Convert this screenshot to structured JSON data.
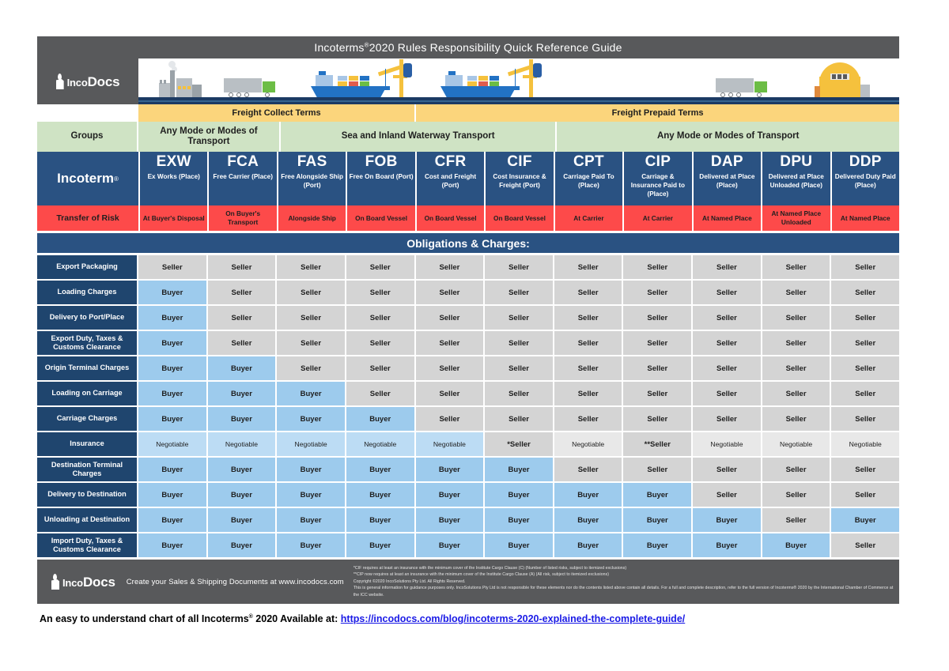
{
  "title": "Incoterms®2020 Rules Responsibility Quick Reference Guide",
  "title_main": "Incoterms",
  "title_reg": "®",
  "title_rest": "2020 Rules Responsibility Quick Reference Guide",
  "brand": {
    "name_inco": "Inco",
    "name_docs": "Docs",
    "full": "IncoDocs"
  },
  "freight_bands": [
    {
      "label": "Freight Collect Terms",
      "span": 4
    },
    {
      "label": "Freight Prepaid Terms",
      "span": 7
    }
  ],
  "groups": {
    "label": "Groups",
    "bands": [
      {
        "label": "Any Mode or Modes of Transport",
        "span": 2
      },
      {
        "label": "Sea and Inland Waterway Transport",
        "span": 4
      },
      {
        "label": "Any Mode or Modes of Transport",
        "span": 5
      }
    ]
  },
  "incoterm": {
    "label": "Incoterm",
    "reg": "®",
    "terms": [
      {
        "code": "EXW",
        "name": "Ex Works (Place)"
      },
      {
        "code": "FCA",
        "name": "Free Carrier (Place)"
      },
      {
        "code": "FAS",
        "name": "Free Alongside Ship (Port)"
      },
      {
        "code": "FOB",
        "name": "Free On Board (Port)"
      },
      {
        "code": "CFR",
        "name": "Cost and Freight (Port)"
      },
      {
        "code": "CIF",
        "name": "Cost Insurance & Freight (Port)"
      },
      {
        "code": "CPT",
        "name": "Carriage Paid To (Place)"
      },
      {
        "code": "CIP",
        "name": "Carriage & Insurance Paid to (Place)"
      },
      {
        "code": "DAP",
        "name": "Delivered at Place (Place)"
      },
      {
        "code": "DPU",
        "name": "Delivered at Place Unloaded (Place)"
      },
      {
        "code": "DDP",
        "name": "Delivered Duty Paid (Place)"
      }
    ]
  },
  "transfer_of_risk": {
    "label": "Transfer of Risk",
    "values": [
      "At Buyer's Disposal",
      "On Buyer's Transport",
      "Alongside Ship",
      "On Board Vessel",
      "On Board Vessel",
      "On Board Vessel",
      "At Carrier",
      "At Carrier",
      "At Named Place",
      "At Named Place Unloaded",
      "At Named Place"
    ]
  },
  "obligations_banner": "Obligations & Charges:",
  "chart_data": {
    "type": "table",
    "title": "Incoterms®2020 Rules Responsibility Quick Reference Guide",
    "columns": [
      "EXW",
      "FCA",
      "FAS",
      "FOB",
      "CFR",
      "CIF",
      "CPT",
      "CIP",
      "DAP",
      "DPU",
      "DDP"
    ],
    "rows": [
      {
        "label": "Export Packaging",
        "values": [
          "Seller",
          "Seller",
          "Seller",
          "Seller",
          "Seller",
          "Seller",
          "Seller",
          "Seller",
          "Seller",
          "Seller",
          "Seller"
        ]
      },
      {
        "label": "Loading Charges",
        "values": [
          "Buyer",
          "Seller",
          "Seller",
          "Seller",
          "Seller",
          "Seller",
          "Seller",
          "Seller",
          "Seller",
          "Seller",
          "Seller"
        ]
      },
      {
        "label": "Delivery to Port/Place",
        "values": [
          "Buyer",
          "Seller",
          "Seller",
          "Seller",
          "Seller",
          "Seller",
          "Seller",
          "Seller",
          "Seller",
          "Seller",
          "Seller"
        ]
      },
      {
        "label": "Export Duty, Taxes & Customs Clearance",
        "values": [
          "Buyer",
          "Seller",
          "Seller",
          "Seller",
          "Seller",
          "Seller",
          "Seller",
          "Seller",
          "Seller",
          "Seller",
          "Seller"
        ]
      },
      {
        "label": "Origin Terminal Charges",
        "values": [
          "Buyer",
          "Buyer",
          "Seller",
          "Seller",
          "Seller",
          "Seller",
          "Seller",
          "Seller",
          "Seller",
          "Seller",
          "Seller"
        ]
      },
      {
        "label": "Loading on Carriage",
        "values": [
          "Buyer",
          "Buyer",
          "Buyer",
          "Seller",
          "Seller",
          "Seller",
          "Seller",
          "Seller",
          "Seller",
          "Seller",
          "Seller"
        ]
      },
      {
        "label": "Carriage Charges",
        "values": [
          "Buyer",
          "Buyer",
          "Buyer",
          "Buyer",
          "Seller",
          "Seller",
          "Seller",
          "Seller",
          "Seller",
          "Seller",
          "Seller"
        ]
      },
      {
        "label": "Insurance",
        "values": [
          "Negotiable",
          "Negotiable",
          "Negotiable",
          "Negotiable",
          "Negotiable",
          "*Seller",
          "Negotiable",
          "**Seller",
          "Negotiable",
          "Negotiable",
          "Negotiable"
        ]
      },
      {
        "label": "Destination Terminal Charges",
        "values": [
          "Buyer",
          "Buyer",
          "Buyer",
          "Buyer",
          "Buyer",
          "Buyer",
          "Seller",
          "Seller",
          "Seller",
          "Seller",
          "Seller"
        ]
      },
      {
        "label": "Delivery to Destination",
        "values": [
          "Buyer",
          "Buyer",
          "Buyer",
          "Buyer",
          "Buyer",
          "Buyer",
          "Buyer",
          "Buyer",
          "Seller",
          "Seller",
          "Seller"
        ]
      },
      {
        "label": "Unloading at Destination",
        "values": [
          "Buyer",
          "Buyer",
          "Buyer",
          "Buyer",
          "Buyer",
          "Buyer",
          "Buyer",
          "Buyer",
          "Buyer",
          "Seller",
          "Buyer"
        ]
      },
      {
        "label": "Import Duty, Taxes & Customs Clearance",
        "values": [
          "Buyer",
          "Buyer",
          "Buyer",
          "Buyer",
          "Buyer",
          "Buyer",
          "Buyer",
          "Buyer",
          "Buyer",
          "Buyer",
          "Seller"
        ]
      }
    ],
    "legend_colors": {
      "seller": "#d4d4d4",
      "buyer": "#9dcbed",
      "negotiable_buyer": "#bcdcf4",
      "negotiable_seller": "#e8e8e8",
      "header_blue": "#2a5282",
      "risk_red": "#fd4a4a",
      "group_green": "#cfe3c4",
      "freight_yellow": "#fbd57c",
      "bar_grey": "#58595b"
    }
  },
  "footer": {
    "tagline": "Create your Sales & Shipping Documents at www.incodocs.com",
    "note_cif": "*CIF requires at least an insurance with the minimum cover of the Institute Cargo Clause (C) (Number of listed risks, subject to itemized exclusions)",
    "note_cip": "**CIP now requires at least an insurance with the minimum cover of the Institute Cargo Clause (A) (All risk, subject to itemized exclusions)",
    "copyright": "Copyright ©2020 IncoSolutions Pty Ltd. All Rights Reserved.",
    "disclaimer": "This is general information for guidance purposes only. IncoSolutions Pty Ltd is not responsible for these elements nor do the contents listed above contain all details. For a full and complete description, refer to the full version of Incoterms® 2020 by the International Chamber of Commerce at the ICC website."
  },
  "caption": {
    "text_before": "An easy to understand chart of all Incoterms",
    "reg": "®",
    "text_mid": " 2020 Available at: ",
    "link": "https://incodocs.com/blog/incoterms-2020-explained-the-complete-guide/"
  }
}
